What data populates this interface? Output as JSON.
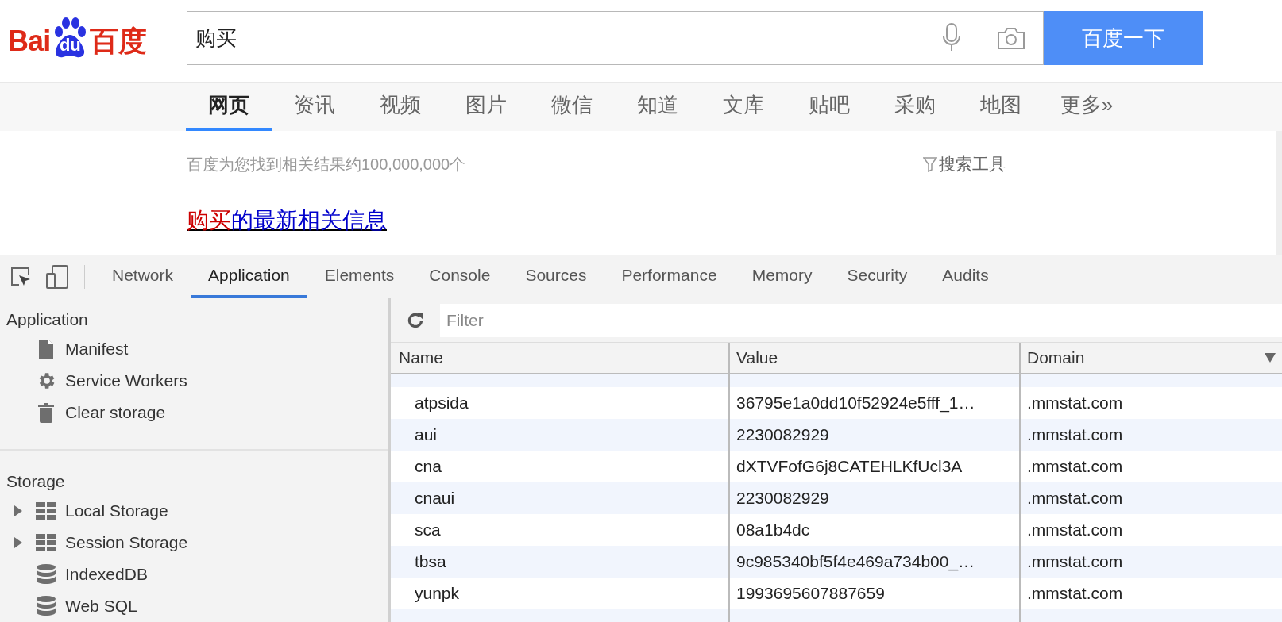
{
  "logo": {
    "left": "Bai",
    "mark": "du",
    "right": "百度"
  },
  "search": {
    "value": "购买",
    "button": "百度一下"
  },
  "nav": [
    {
      "label": "网页",
      "selected": true
    },
    {
      "label": "资讯",
      "selected": false
    },
    {
      "label": "视频",
      "selected": false
    },
    {
      "label": "图片",
      "selected": false
    },
    {
      "label": "微信",
      "selected": false
    },
    {
      "label": "知道",
      "selected": false
    },
    {
      "label": "文库",
      "selected": false
    },
    {
      "label": "贴吧",
      "selected": false
    },
    {
      "label": "采购",
      "selected": false
    },
    {
      "label": "地图",
      "selected": false
    },
    {
      "label": "更多»",
      "selected": false
    }
  ],
  "results": {
    "count": "百度为您找到相关结果约100,000,000个",
    "tools": "搜索工具",
    "title": [
      {
        "text": "购买",
        "highlight": true
      },
      {
        "text": "的最新相关信息",
        "highlight": false
      }
    ]
  },
  "devtools": {
    "tabs": [
      {
        "label": "Network",
        "selected": false
      },
      {
        "label": "Application",
        "selected": true
      },
      {
        "label": "Elements",
        "selected": false
      },
      {
        "label": "Console",
        "selected": false
      },
      {
        "label": "Sources",
        "selected": false
      },
      {
        "label": "Performance",
        "selected": false
      },
      {
        "label": "Memory",
        "selected": false
      },
      {
        "label": "Security",
        "selected": false
      },
      {
        "label": "Audits",
        "selected": false
      }
    ],
    "sidebar": [
      {
        "heading": "Application",
        "items": [
          {
            "label": "Manifest",
            "kind": "file"
          },
          {
            "label": "Service Workers",
            "kind": "gear"
          },
          {
            "label": "Clear storage",
            "kind": "trash"
          }
        ]
      },
      {
        "heading": "Storage",
        "items": [
          {
            "label": "Local Storage",
            "kind": "table",
            "expanded": false
          },
          {
            "label": "Session Storage",
            "kind": "table",
            "expanded": false
          },
          {
            "label": "IndexedDB",
            "kind": "database"
          },
          {
            "label": "Web SQL",
            "kind": "database"
          }
        ]
      }
    ],
    "filter": {
      "placeholder": "Filter"
    },
    "table": {
      "columns": [
        "Name",
        "Value",
        "Domain"
      ],
      "rows": [
        [
          "atpsida",
          "36795e1a0dd10f52924e5fff_1…",
          ".mmstat.com"
        ],
        [
          "aui",
          "2230082929",
          ".mmstat.com"
        ],
        [
          "cna",
          "dXTVFofG6j8CATEHLKfUcl3A",
          ".mmstat.com"
        ],
        [
          "cnaui",
          "2230082929",
          ".mmstat.com"
        ],
        [
          "sca",
          "08a1b4dc",
          ".mmstat.com"
        ],
        [
          "tbsa",
          "9c985340bf5f4e469a734b00_…",
          ".mmstat.com"
        ],
        [
          "yunpk",
          "1993695607887659",
          ".mmstat.com"
        ]
      ]
    }
  }
}
